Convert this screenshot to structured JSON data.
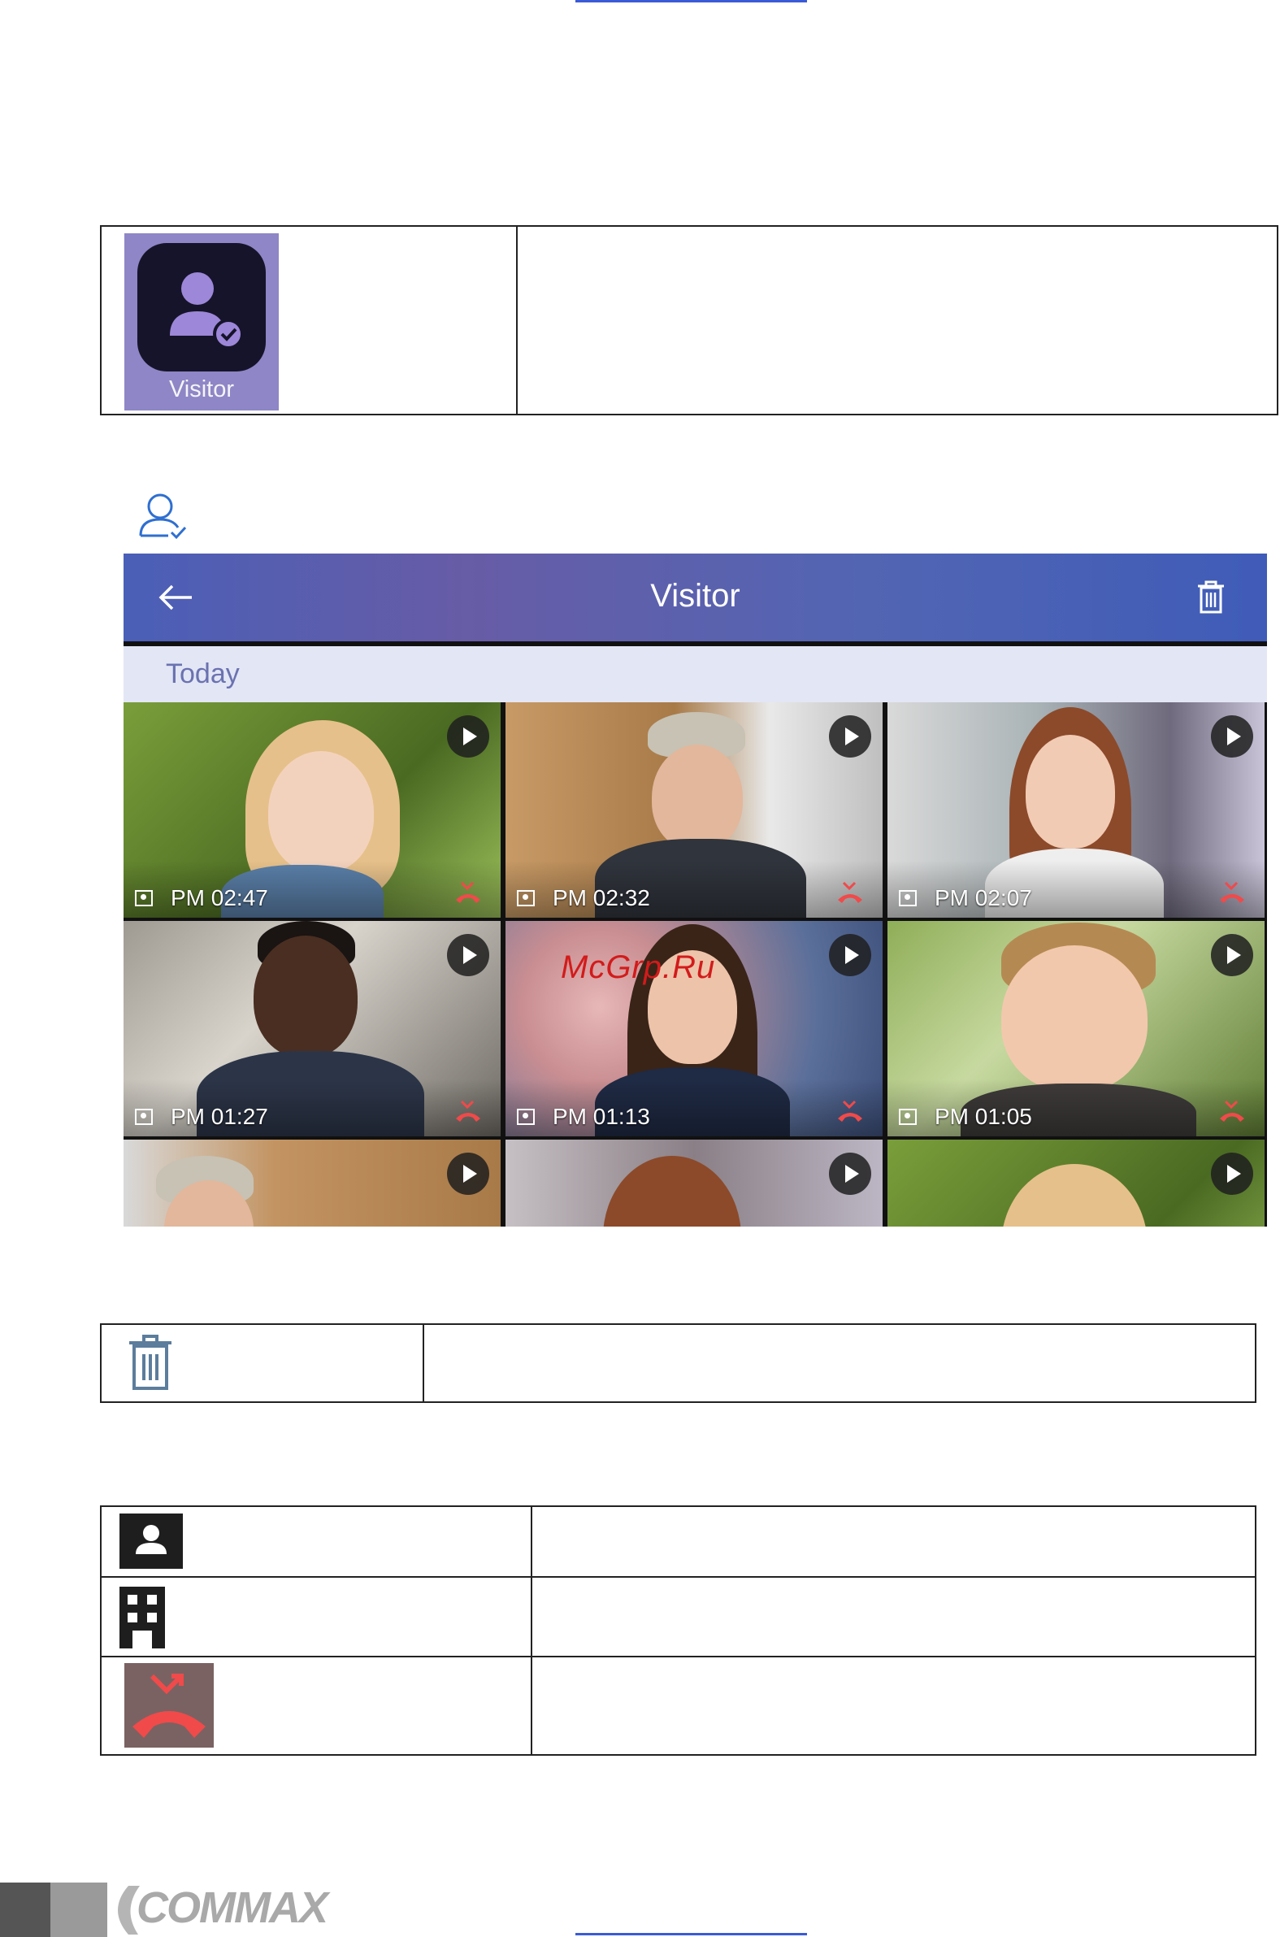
{
  "app_icon": {
    "label": "Visitor",
    "icon": "visitor-person-check-icon"
  },
  "screen": {
    "title": "Visitor",
    "back_icon": "back-arrow-icon",
    "delete_icon": "trash-icon",
    "date_group": "Today",
    "thumbnails": [
      {
        "time": "PM 02:47",
        "subject": "child-girl"
      },
      {
        "time": "PM 02:32",
        "subject": "delivery-man"
      },
      {
        "time": "PM 02:07",
        "subject": "young-woman"
      },
      {
        "time": "PM 01:27",
        "subject": "young-man"
      },
      {
        "time": "PM 01:13",
        "subject": "woman"
      },
      {
        "time": "PM 01:05",
        "subject": "boy"
      },
      {
        "time": "",
        "subject": "delivery-man"
      },
      {
        "time": "",
        "subject": "woman"
      },
      {
        "time": "",
        "subject": "child-girl"
      }
    ]
  },
  "watermark": "McGrp.Ru",
  "icons_table": [
    {
      "icon": "person-card-icon"
    },
    {
      "icon": "building-icon"
    },
    {
      "icon": "missed-call-icon"
    }
  ],
  "footer": {
    "brand": "COMMAX"
  },
  "colors": {
    "header": "#5a63b0",
    "date_bar": "#e3e6f5",
    "missed_call": "#f04a4a"
  }
}
